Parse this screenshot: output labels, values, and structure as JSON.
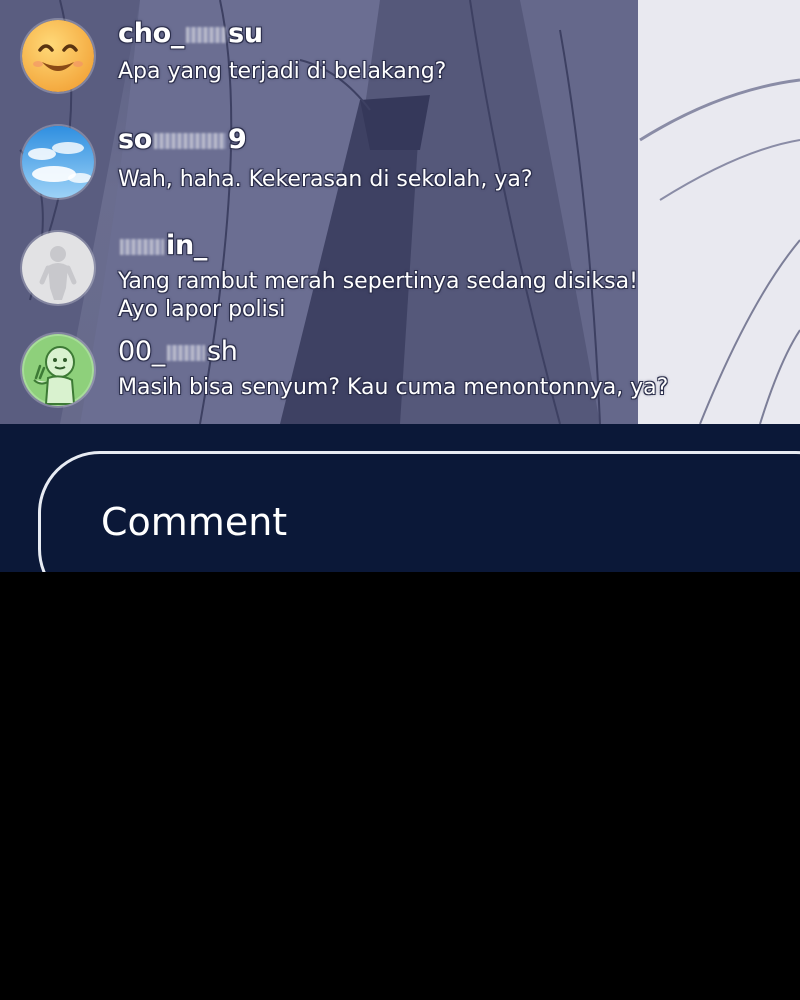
{
  "chat": {
    "messages": [
      {
        "avatar": "smiling-face-avatar",
        "username_prefix": "cho_",
        "username_suffix": "su",
        "lines": [
          "Apa yang terjadi di belakang?"
        ]
      },
      {
        "avatar": "sky-clouds-avatar",
        "username_prefix": "so",
        "username_suffix": "9",
        "lines": [
          "Wah, haha. Kekerasan di sekolah, ya?"
        ]
      },
      {
        "avatar": "default-silhouette-avatar",
        "username_prefix": "",
        "username_suffix": "in_",
        "lines": [
          "Yang rambut merah sepertinya sedang disiksa!",
          "Ayo lapor polisi"
        ]
      },
      {
        "avatar": "green-character-avatar",
        "username_prefix": "00_",
        "username_suffix": "sh",
        "lines": [
          "Masih bisa senyum? Kau cuma menontonnya, ya?"
        ]
      }
    ]
  },
  "comment_input": {
    "placeholder": "Comment"
  },
  "colors": {
    "comment_bar_bg": "#0b1838",
    "comment_border": "#e7ebf3",
    "stream_tint": "#62668a"
  }
}
